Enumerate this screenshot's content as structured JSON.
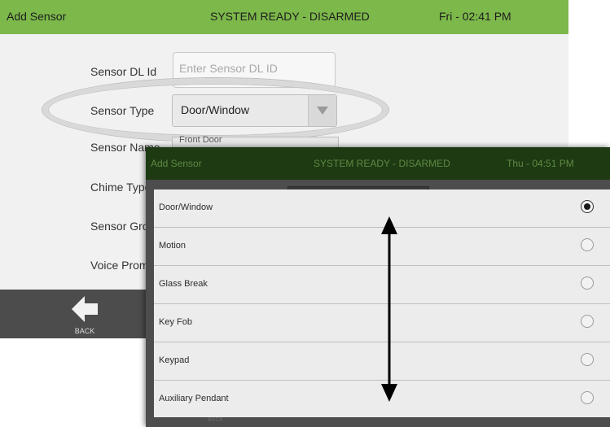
{
  "back_screen": {
    "header": {
      "title": "Add Sensor",
      "status": "SYSTEM READY - DISARMED",
      "time": "Fri - 02:41 PM",
      "color": "#7cb84a"
    },
    "fields": {
      "dl_id": {
        "label": "Sensor DL Id",
        "placeholder": "Enter Sensor DL ID"
      },
      "type": {
        "label": "Sensor Type",
        "value": "Door/Window"
      },
      "name": {
        "label": "Sensor Name",
        "value": "Front Door"
      },
      "chime": {
        "label": "Chime Type"
      },
      "group": {
        "label": "Sensor Group"
      },
      "voice": {
        "label": "Voice Prompts"
      }
    },
    "footer": {
      "back_label": "BACK"
    }
  },
  "front_screen": {
    "header": {
      "title": "Add Sensor",
      "status": "SYSTEM READY - DISARMED",
      "time": "Thu - 04:51 PM"
    },
    "options": [
      {
        "label": "Door/Window",
        "selected": true
      },
      {
        "label": "Motion",
        "selected": false
      },
      {
        "label": "Glass Break",
        "selected": false
      },
      {
        "label": "Key Fob",
        "selected": false
      },
      {
        "label": "Keypad",
        "selected": false
      },
      {
        "label": "Auxiliary Pendant",
        "selected": false
      }
    ],
    "footer": {
      "back_label": "BACK"
    }
  },
  "annotations": {
    "highlight": "ellipse around Sensor Type",
    "arrow": "vertical scroll indicator"
  }
}
